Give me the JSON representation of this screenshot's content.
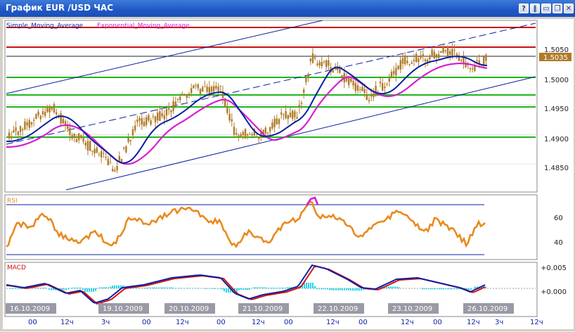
{
  "window": {
    "title": "График EUR /USD  ЧАС",
    "buttons": [
      {
        "name": "help-icon",
        "glyph": "?"
      },
      {
        "name": "pause-icon",
        "glyph": "‖"
      },
      {
        "name": "minimize-icon",
        "glyph": "▭"
      },
      {
        "name": "restore-icon",
        "glyph": "❐"
      },
      {
        "name": "close-icon",
        "glyph": "✕"
      }
    ]
  },
  "price_panel": {
    "legend_sma": "Simple_Moving_Average",
    "legend_ema": "Exponential_Moving_Average",
    "price_labels": [
      "1.5050",
      "1.5000",
      "1.4950",
      "1.4900",
      "1.4850"
    ],
    "current_price": "1.5035"
  },
  "rsi_panel": {
    "label": "RSI",
    "ticks": [
      "60",
      "40"
    ]
  },
  "macd_panel": {
    "label": "MACD",
    "ticks": [
      "+0.005",
      "+0.000"
    ]
  },
  "time_axis": {
    "dates": [
      "16.10.2009",
      "19.10.2009",
      "20.10.2009",
      "21.10.2009",
      "22.10.2009",
      "23.10.2009",
      "26.10.2009"
    ],
    "hours": [
      "00",
      "12ч",
      "3ч",
      "00",
      "12ч",
      "00",
      "12ч",
      "00",
      "12ч",
      "00",
      "12ч",
      "00",
      "12ч",
      "3ч",
      "12ч"
    ]
  },
  "colors": {
    "sma": "#0a1fa0",
    "ema": "#d61fd0",
    "candle": "#b07a28",
    "rsi": "#e98a1e",
    "macd_signal": "#d41010",
    "macd_hist": "#27d2e6",
    "support": "#1eb51e",
    "resistance": "#c80f0f"
  }
}
